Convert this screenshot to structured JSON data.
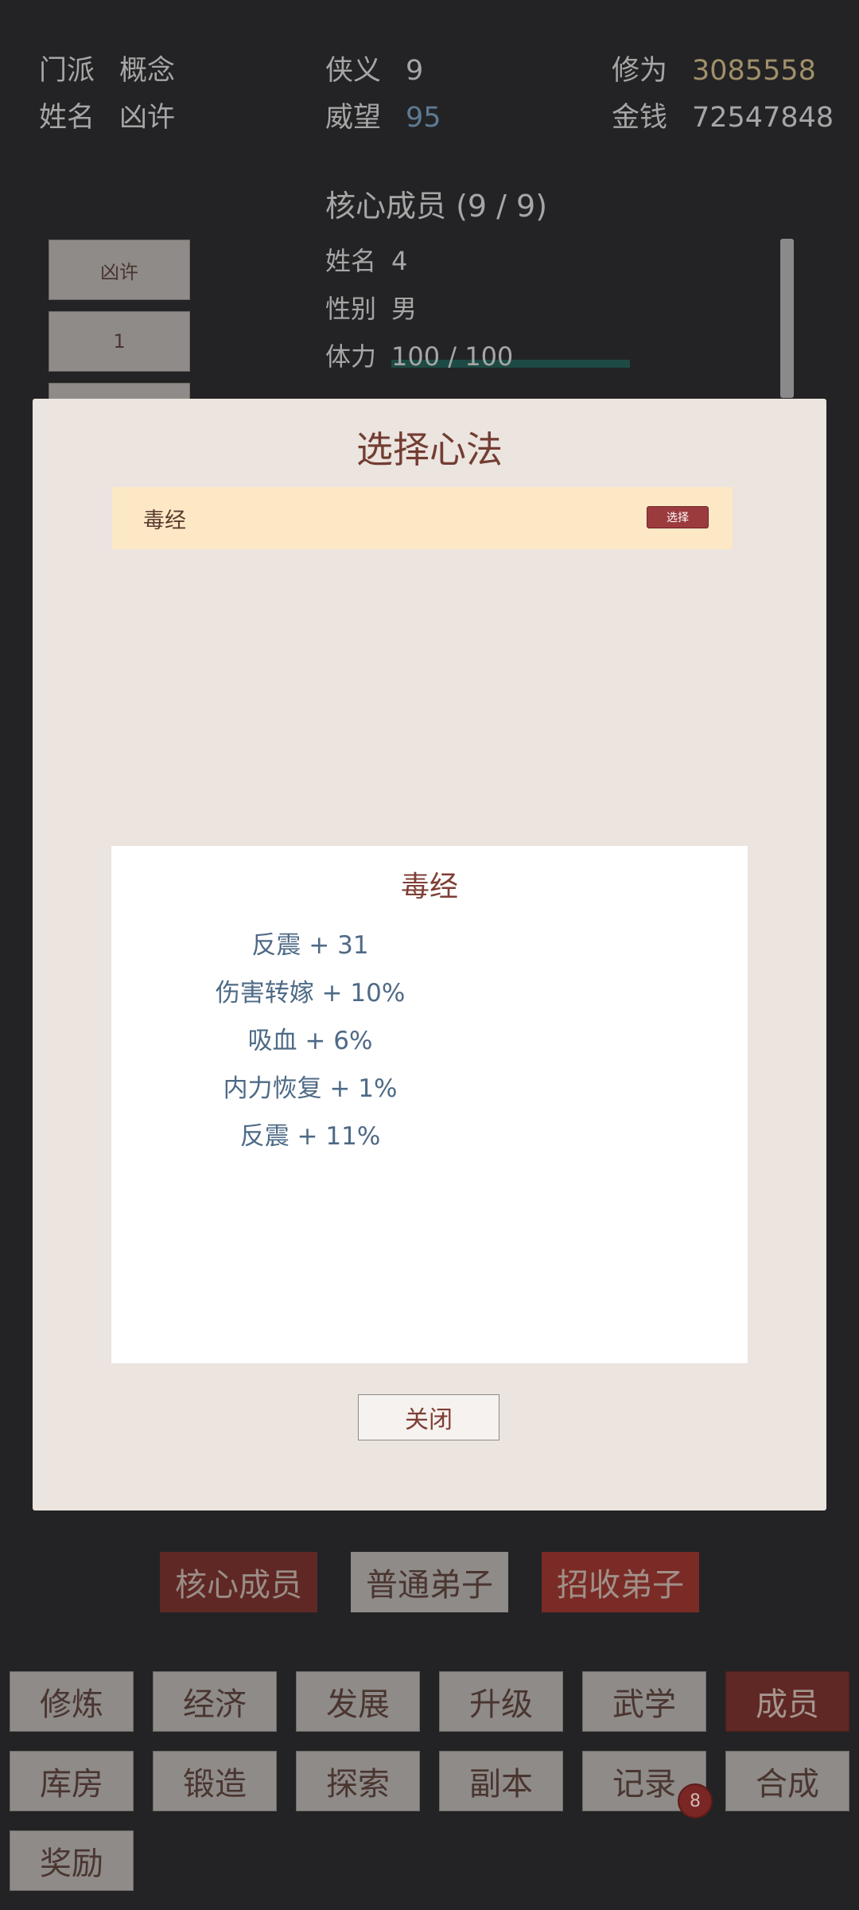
{
  "header": {
    "sect_label": "门派",
    "sect_value": "概念",
    "name_label": "姓名",
    "name_value": "凶许",
    "chivalry_label": "侠义",
    "chivalry_value": "9",
    "prestige_label": "威望",
    "prestige_value": "95",
    "cultivation_label": "修为",
    "cultivation_value": "3085558",
    "money_label": "金钱",
    "money_value": "72547848"
  },
  "members": {
    "section_title": "核心成员 (9 / 9)",
    "list": [
      "凶许",
      "1"
    ],
    "detail": {
      "name_label": "姓名",
      "name_value": "4",
      "gender_label": "性别",
      "gender_value": "男",
      "stamina_label": "体力",
      "stamina_value": "100 / 100",
      "stamina_fraction": 1.0
    }
  },
  "modal": {
    "title": "选择心法",
    "items": [
      {
        "name": "毒经",
        "select_label": "选择"
      }
    ],
    "detail_title": "毒经",
    "attributes": [
      "反震 + 31",
      "伤害转嫁 + 10%",
      "吸血 + 6%",
      "内力恢复 + 1%",
      "反震 + 11%"
    ],
    "close_label": "关闭"
  },
  "tabs": [
    "核心成员",
    "普通弟子",
    "招收弟子"
  ],
  "nav": {
    "row1": [
      "修炼",
      "经济",
      "发展",
      "升级",
      "武学",
      "成员"
    ],
    "row2": [
      "库房",
      "锻造",
      "探索",
      "副本",
      "记录",
      "合成"
    ],
    "row3": [
      "奖励"
    ],
    "active": "成员",
    "badge": "8"
  },
  "colors": {
    "background": "#232325",
    "modal": "#ebe4df",
    "accent_red": "#9c3b3e",
    "gold": "#a0906a",
    "blue": "#5d7a93"
  }
}
